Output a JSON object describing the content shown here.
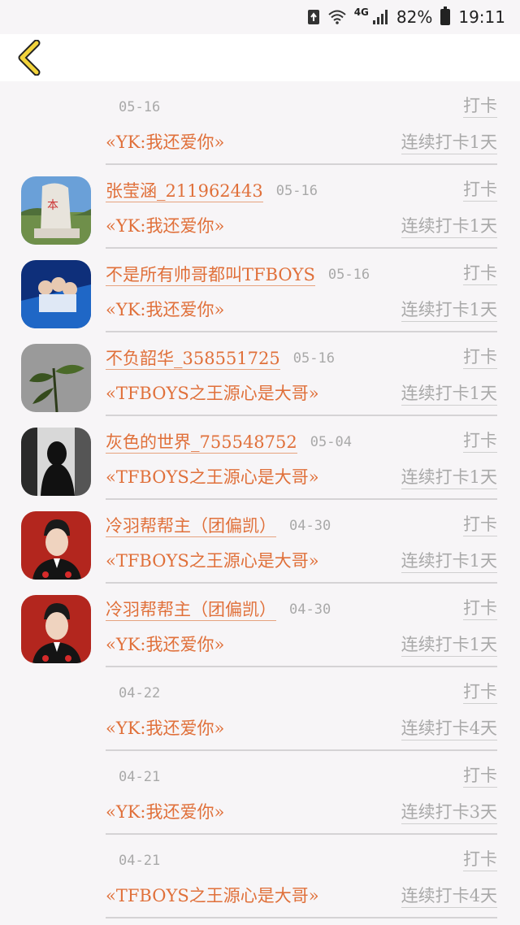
{
  "status_bar": {
    "network": "4G",
    "battery": "82%",
    "time": "19:11"
  },
  "header": {
    "back_icon": "chevron-left-icon",
    "accent_color": "#f2d33b"
  },
  "rows": [
    {
      "name": "",
      "date": "05-16",
      "checkin": "打卡",
      "book": "«YK:我还爱你»",
      "streak": "连续打卡1天",
      "has_avatar": false
    },
    {
      "name": "张莹涵_211962443",
      "date": "05-16",
      "checkin": "打卡",
      "book": "«YK:我还爱你»",
      "streak": "连续打卡1天",
      "has_avatar": true
    },
    {
      "name": "不是所有帅哥都叫TFBOYS",
      "date": "05-16",
      "checkin": "打卡",
      "book": "«YK:我还爱你»",
      "streak": "连续打卡1天",
      "has_avatar": true
    },
    {
      "name": "不负韶华_358551725",
      "date": "05-16",
      "checkin": "打卡",
      "book": "«TFBOYS之王源心是大哥»",
      "streak": "连续打卡1天",
      "has_avatar": true
    },
    {
      "name": "灰色的世界_755548752",
      "date": "05-04",
      "checkin": "打卡",
      "book": "«TFBOYS之王源心是大哥»",
      "streak": "连续打卡1天",
      "has_avatar": true
    },
    {
      "name": "冷羽帮帮主（团偏凯）",
      "date": "04-30",
      "checkin": "打卡",
      "book": "«TFBOYS之王源心是大哥»",
      "streak": "连续打卡1天",
      "has_avatar": true
    },
    {
      "name": "冷羽帮帮主（团偏凯）",
      "date": "04-30",
      "checkin": "打卡",
      "book": "«YK:我还爱你»",
      "streak": "连续打卡1天",
      "has_avatar": true
    },
    {
      "name": "",
      "date": "04-22",
      "checkin": "打卡",
      "book": "«YK:我还爱你»",
      "streak": "连续打卡4天",
      "has_avatar": false
    },
    {
      "name": "",
      "date": "04-21",
      "checkin": "打卡",
      "book": "«YK:我还爱你»",
      "streak": "连续打卡3天",
      "has_avatar": false
    },
    {
      "name": "",
      "date": "04-21",
      "checkin": "打卡",
      "book": "«TFBOYS之王源心是大哥»",
      "streak": "连续打卡4天",
      "has_avatar": false
    }
  ]
}
